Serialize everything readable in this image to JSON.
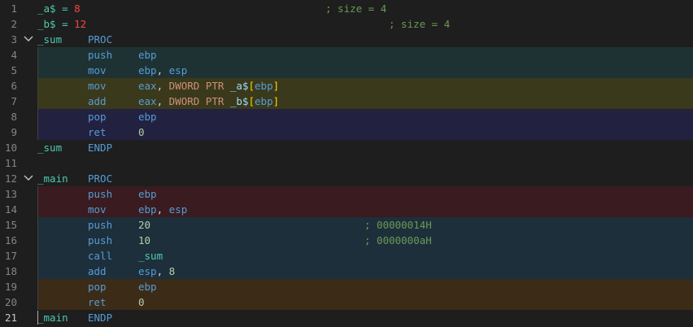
{
  "editor": {
    "colors": {
      "background": "#1e1e1e",
      "line_number": "#858585",
      "band_dark_teal": "#1e3234",
      "band_olive": "#3a391b",
      "band_navy": "#22213f",
      "band_maroon": "#3a1b1f",
      "band_slate": "#1d2f3b",
      "band_brown": "#3b2b17"
    },
    "lines": [
      {
        "num": "1",
        "fold": "",
        "band": "",
        "col1": "_a$ = ",
        "col1b": "8",
        "col2": "",
        "col3": "",
        "comment": "; size = 4",
        "comment_pos": "mid"
      },
      {
        "num": "2",
        "fold": "",
        "band": "",
        "col1": "_b$ = ",
        "col1b": "12",
        "col2": "",
        "col3": "",
        "comment": "; size = 4",
        "comment_pos": "far"
      },
      {
        "num": "3",
        "fold": "chevron-down-icon",
        "band": "",
        "col1": "_sum",
        "col1b": "",
        "col2": "PROC",
        "col3": "",
        "comment": ""
      },
      {
        "num": "4",
        "fold": "",
        "band": "band_dark_teal",
        "col1": "",
        "col1b": "",
        "col2": "push",
        "col3": "ebp",
        "comment": ""
      },
      {
        "num": "5",
        "fold": "",
        "band": "band_dark_teal",
        "col1": "",
        "col1b": "",
        "col2": "mov",
        "col3": "ebp, esp",
        "comment": ""
      },
      {
        "num": "6",
        "fold": "",
        "band": "band_olive",
        "col1": "",
        "col1b": "",
        "col2": "mov",
        "col3": "eax, DWORD PTR _a$[ebp]",
        "comment": ""
      },
      {
        "num": "7",
        "fold": "",
        "band": "band_olive",
        "col1": "",
        "col1b": "",
        "col2": "add",
        "col3": "eax, DWORD PTR _b$[ebp]",
        "comment": ""
      },
      {
        "num": "8",
        "fold": "",
        "band": "band_navy",
        "col1": "",
        "col1b": "",
        "col2": "pop",
        "col3": "ebp",
        "comment": ""
      },
      {
        "num": "9",
        "fold": "",
        "band": "band_navy",
        "col1": "",
        "col1b": "",
        "col2": "ret",
        "col3": "0",
        "comment": ""
      },
      {
        "num": "10",
        "fold": "",
        "band": "",
        "col1": "_sum",
        "col1b": "",
        "col2": "ENDP",
        "col3": "",
        "comment": ""
      },
      {
        "num": "11",
        "fold": "",
        "band": "",
        "col1": "",
        "col1b": "",
        "col2": "",
        "col3": "",
        "comment": ""
      },
      {
        "num": "12",
        "fold": "chevron-down-icon",
        "band": "",
        "col1": "_main",
        "col1b": "",
        "col2": "PROC",
        "col3": "",
        "comment": ""
      },
      {
        "num": "13",
        "fold": "",
        "band": "band_maroon",
        "col1": "",
        "col1b": "",
        "col2": "push",
        "col3": "ebp",
        "comment": ""
      },
      {
        "num": "14",
        "fold": "",
        "band": "band_maroon",
        "col1": "",
        "col1b": "",
        "col2": "mov",
        "col3": "ebp, esp",
        "comment": ""
      },
      {
        "num": "15",
        "fold": "",
        "band": "band_slate",
        "col1": "",
        "col1b": "",
        "col2": "push",
        "col3": "20",
        "comment": "; 00000014H",
        "comment_pos": "right"
      },
      {
        "num": "16",
        "fold": "",
        "band": "band_slate",
        "col1": "",
        "col1b": "",
        "col2": "push",
        "col3": "10",
        "comment": "; 0000000aH",
        "comment_pos": "right"
      },
      {
        "num": "17",
        "fold": "",
        "band": "band_slate",
        "col1": "",
        "col1b": "",
        "col2": "call",
        "col3": "_sum",
        "comment": ""
      },
      {
        "num": "18",
        "fold": "",
        "band": "band_slate",
        "col1": "",
        "col1b": "",
        "col2": "add",
        "col3": "esp, 8",
        "comment": ""
      },
      {
        "num": "19",
        "fold": "",
        "band": "band_brown",
        "col1": "",
        "col1b": "",
        "col2": "pop",
        "col3": "ebp",
        "comment": ""
      },
      {
        "num": "20",
        "fold": "",
        "band": "band_brown",
        "col1": "",
        "col1b": "",
        "col2": "ret",
        "col3": "0",
        "comment": ""
      },
      {
        "num": "21",
        "fold": "",
        "band": "",
        "col1": "_main",
        "col1b": "",
        "col2": "ENDP",
        "col3": "",
        "comment": "",
        "active": true
      }
    ]
  }
}
